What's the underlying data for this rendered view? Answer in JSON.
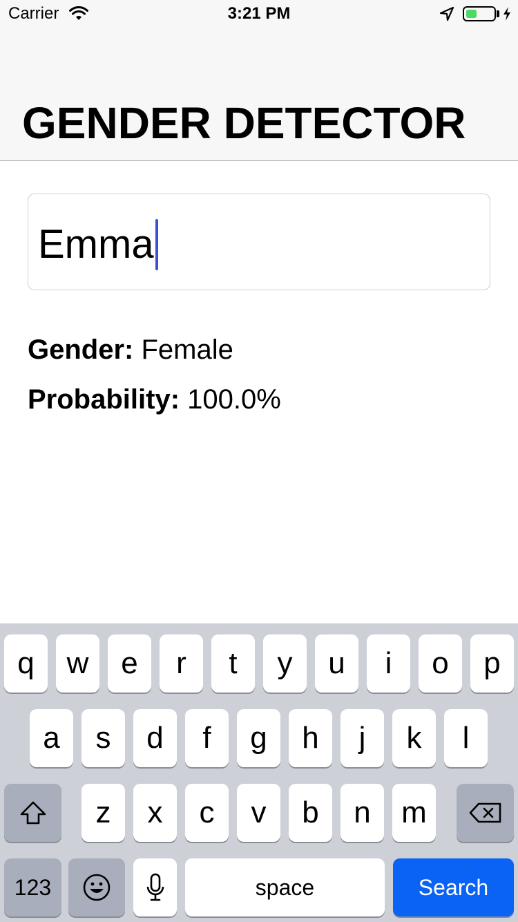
{
  "status_bar": {
    "carrier": "Carrier",
    "time": "3:21 PM",
    "icons": [
      "wifi-icon",
      "location-arrow-icon",
      "battery-icon",
      "charging-bolt-icon"
    ],
    "battery_level_fraction": 0.4,
    "battery_color": "#4cd964"
  },
  "nav": {
    "title": "GENDER DETECTOR"
  },
  "input": {
    "value": "Emma",
    "caret_color": "#3b4fd8"
  },
  "result": {
    "gender_label": "Gender:",
    "gender_value": " Female",
    "probability_label": "Probability:",
    "probability_value": " 100.0%"
  },
  "keyboard": {
    "row1": [
      "q",
      "w",
      "e",
      "r",
      "t",
      "y",
      "u",
      "i",
      "o",
      "p"
    ],
    "row2": [
      "a",
      "s",
      "d",
      "f",
      "g",
      "h",
      "j",
      "k",
      "l"
    ],
    "row3": [
      "z",
      "x",
      "c",
      "v",
      "b",
      "n",
      "m"
    ],
    "numbers_label": "123",
    "space_label": "space",
    "search_label": "Search",
    "search_color": "#0a63f5",
    "icons": [
      "shift-icon",
      "backspace-icon",
      "emoji-icon",
      "microphone-icon"
    ]
  }
}
